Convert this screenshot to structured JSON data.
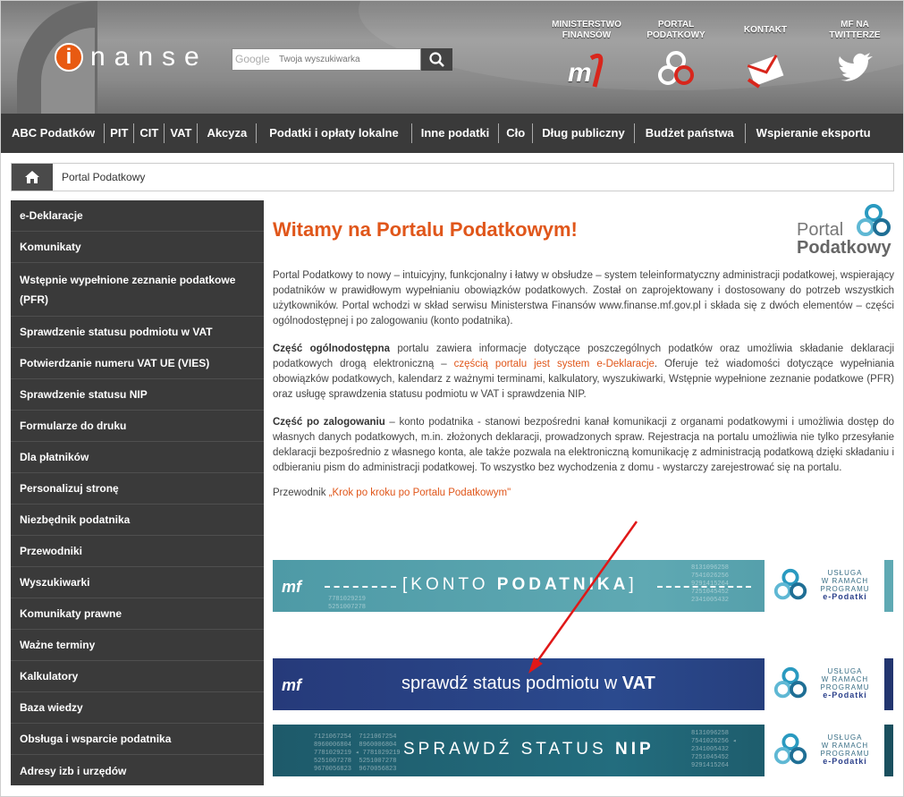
{
  "header": {
    "logo_letter": "i",
    "logo_word": "nanse",
    "search_placeholder": "Twoja wyszukiwarka",
    "google_label": "Google",
    "links": [
      {
        "label_line1": "MINISTERSTWO",
        "label_line2": "FINANSÓW",
        "icon": "mf-logo-icon"
      },
      {
        "label_line1": "PORTAL",
        "label_line2": "PODATKOWY",
        "icon": "portal-podatkowy-icon"
      },
      {
        "label_line1": "KONTAKT",
        "label_line2": "",
        "icon": "contact-envelope-icon"
      },
      {
        "label_line1": "MF NA",
        "label_line2": "TWITTERZE",
        "icon": "twitter-bird-icon"
      }
    ]
  },
  "nav": [
    "ABC Podatków",
    "PIT",
    "CIT",
    "VAT",
    "Akcyza",
    "Podatki i opłaty lokalne",
    "Inne podatki",
    "Cło",
    "Dług publiczny",
    "Budżet państwa",
    "Wspieranie eksportu"
  ],
  "breadcrumb": {
    "current": "Portal Podatkowy"
  },
  "sidebar": [
    "e-Deklaracje",
    "Komunikaty",
    "Wstępnie wypełnione zeznanie podatkowe (PFR)",
    "Sprawdzenie statusu podmiotu w VAT",
    "Potwierdzanie numeru VAT UE (VIES)",
    "Sprawdzenie statusu NIP",
    "Formularze do druku",
    "Dla płatników",
    "Personalizuj stronę",
    "Niezbędnik podatnika",
    "Przewodniki",
    "Wyszukiwarki",
    "Komunikaty prawne",
    "Ważne terminy",
    "Kalkulatory",
    "Baza wiedzy",
    "Obsługa i wsparcie podatnika",
    "Adresy izb i urzędów"
  ],
  "main": {
    "title": "Witamy na Portalu Podatkowym!",
    "pp_logo_line1": "Portal",
    "pp_logo_line2": "Podatkowy",
    "p1": "Portal Podatkowy to nowy – intuicyjny, funkcjonalny i łatwy w obsłudze – system teleinformatyczny administracji podatkowej, wspierający podatników w prawidłowym wypełnianiu obowiązków podatkowych. Został on zaprojektowany i dostosowany do potrzeb wszystkich użytkowników. Portal wchodzi w skład serwisu Ministerstwa Finansów www.finanse.mf.gov.pl i składa się z dwóch elementów – części ogólnodostępnej i po zalogowaniu (konto podatnika).",
    "p2_bold": "Część ogólnodostępna",
    "p2_a": " portalu zawiera informacje dotyczące poszczególnych podatków oraz umożliwia składanie deklaracji podatkowych drogą elektroniczną – ",
    "p2_link": "częścią portalu jest system e-Deklaracje",
    "p2_b": ". Oferuje też wiadomości dotyczące wypełniania obowiązków podatkowych, kalendarz z ważnymi terminami, kalkulatory, wyszukiwarki, Wstępnie wypełnione zeznanie podatkowe (PFR) oraz usługę sprawdzenia statusu podmiotu w VAT i sprawdzenia NIP.",
    "p3_bold": "Część po zalogowaniu",
    "p3_a": " – konto podatnika - stanowi bezpośredni kanał komunikacji z organami podatkowymi i umożliwia dostęp do własnych danych podatkowych, m.in. złożonych deklaracji, prowadzonych spraw. Rejestracja na portalu umożliwia nie tylko przesyłanie deklaracji bezpośrednio z własnego konta, ale także pozwala na elektroniczną komunikację z administracją podatkową dzięki składaniu i odbieraniu pism do administracji podatkowej. To wszystko bez wychodzenia z domu - wystarczy zarejestrować się na portalu.",
    "guide_prefix": "Przewodnik ",
    "guide_link": "„Krok po kroku po Portalu Podatkowym\""
  },
  "banners": [
    {
      "text_a": "[KONTO ",
      "text_b": "PODATNIKA",
      "text_c": "]",
      "mf": "mf",
      "usluga": [
        "USŁUGA",
        "W RAMACH",
        "PROGRAMU"
      ],
      "prog": "e-Podatki",
      "color": "#4e9aa6"
    },
    {
      "text_a": "sprawdź status podmiotu w ",
      "text_b": "VAT",
      "text_c": "",
      "mf": "mf",
      "usluga": [
        "USŁUGA",
        "W RAMACH",
        "PROGRAMU"
      ],
      "prog": "e-Podatki",
      "color": "#263a7a"
    },
    {
      "text_a": "SPRAWDŹ STATUS ",
      "text_b": "NIP",
      "text_c": "",
      "mf": "",
      "usluga": [
        "USŁUGA",
        "W RAMACH",
        "PROGRAMU"
      ],
      "prog": "e-Podatki",
      "color": "#1e5a6a"
    }
  ],
  "banner_numbers": {
    "konto": "8131096258\n7541026256\n9291415264\n7251045452\n2341005432",
    "konto_left": "7781029219\n5251007278",
    "nip_left": "7121067254  7121067254\n8960006804  8960006804\n7781029219 ◂ 7781029219\n5251007278  5251007278\n9670056823  9670056823",
    "nip_right": "8131096258\n7541026256 ◂\n2341005432\n7251045452\n9291415264"
  },
  "colors": {
    "accent": "#e0561a",
    "nav_bg": "#3a3a3a",
    "sidebar_bg": "#3a3a3a"
  }
}
